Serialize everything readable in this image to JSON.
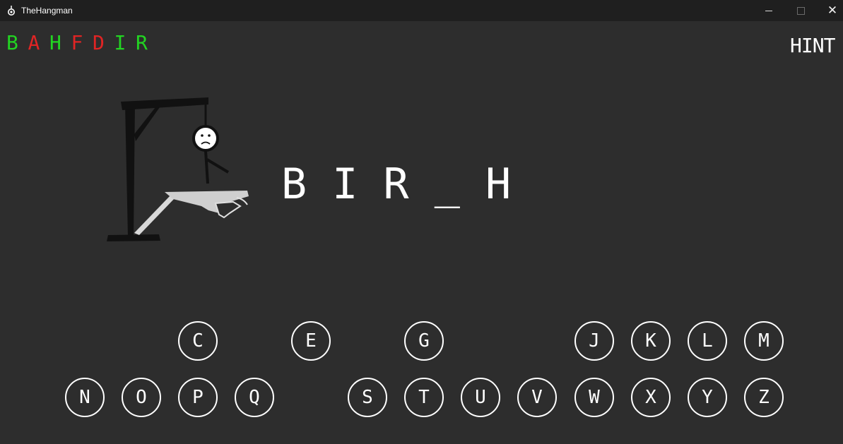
{
  "window": {
    "title": "TheHangman",
    "close_glyph": "✕"
  },
  "guessed_letters": [
    {
      "letter": "B",
      "color": "#22d422"
    },
    {
      "letter": "A",
      "color": "#e02424"
    },
    {
      "letter": "H",
      "color": "#22d422"
    },
    {
      "letter": "F",
      "color": "#e02424"
    },
    {
      "letter": "D",
      "color": "#e02424"
    },
    {
      "letter": "I",
      "color": "#22d422"
    },
    {
      "letter": "R",
      "color": "#22d422"
    }
  ],
  "hint_label": "HINT",
  "word_display": "B I R _ H",
  "keyboard": {
    "row1": [
      "C",
      "E",
      "G",
      "J",
      "K",
      "L",
      "M"
    ],
    "row2": [
      "N",
      "O",
      "P",
      "Q",
      "S",
      "T",
      "U",
      "V",
      "W",
      "X",
      "Y",
      "Z"
    ]
  },
  "colors": {
    "background": "#2d2d2d",
    "titlebar": "#1f1f1f",
    "correct": "#22d422",
    "wrong": "#e02424"
  }
}
